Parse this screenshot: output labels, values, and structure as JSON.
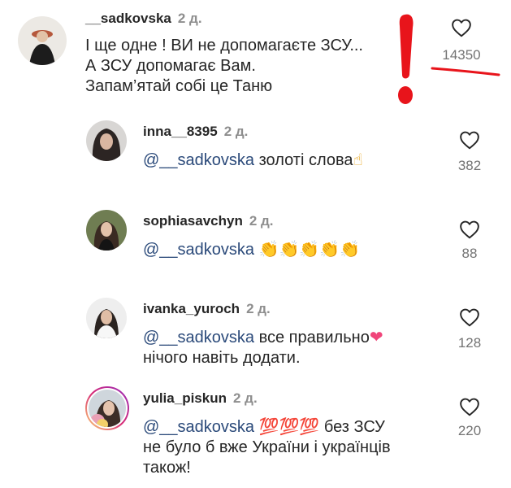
{
  "comments": [
    {
      "username": "__sadkovska",
      "time": "2 д.",
      "lines": [
        "І ще одне ! ВИ не допомагаєте ЗСУ...",
        "А ЗСУ допомагає Вам.",
        "Запам’ятай собі це Таню"
      ],
      "likes": "14350",
      "icon": "heart-outline-icon"
    },
    {
      "username": "inna__8395",
      "time": "2 д.",
      "mention": "@__sadkovska",
      "text": " золоті слова",
      "emoji": "☝",
      "likes": "382",
      "icon": "heart-outline-icon"
    },
    {
      "username": "sophiasavchyn",
      "time": "2 д.",
      "mention": "@__sadkovska",
      "text": " ",
      "emoji": "👏👏👏👏👏",
      "likes": "88",
      "icon": "heart-outline-icon"
    },
    {
      "username": "ivanka_yuroch",
      "time": "2 д.",
      "mention": "@__sadkovska",
      "text": " все правильно",
      "emoji": "❤",
      "line2": "нічого навіть додати.",
      "likes": "128",
      "icon": "heart-outline-icon"
    },
    {
      "username": "yulia_piskun",
      "time": "2 д.",
      "mention": "@__sadkovska",
      "text": " ",
      "emoji": "💯💯💯",
      "text_after": " без ЗСУ",
      "line2": "не було б вже України і українців",
      "line3": "також!",
      "likes": "220",
      "icon": "heart-outline-icon"
    }
  ],
  "colors": {
    "text": "#262626",
    "secondary": "#8e8e8e",
    "mention": "#2b4a7a",
    "annotation": "#e8141b",
    "story_ring": "#d62976"
  }
}
